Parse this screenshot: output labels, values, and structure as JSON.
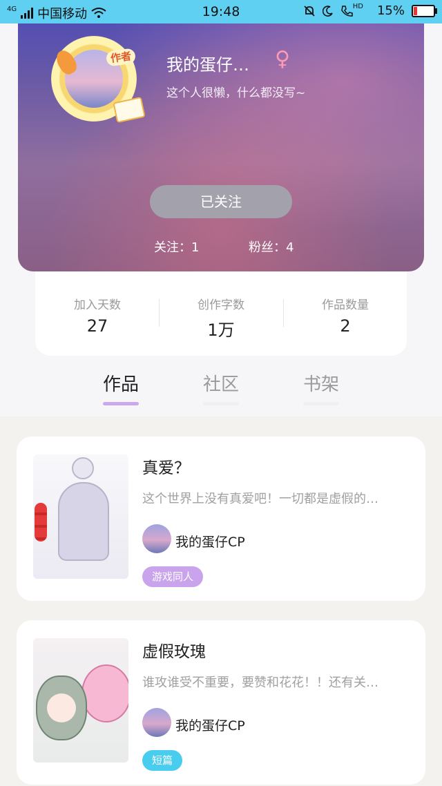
{
  "status_bar": {
    "network": "4G",
    "carrier": "中国移动",
    "time": "19:48",
    "hd": "HD",
    "battery": "15%",
    "battery_level": 0.15,
    "battery_color": "#e53935"
  },
  "profile": {
    "author_badge": "作者",
    "nickname": "我的蛋仔…",
    "gender_symbol": "♀",
    "bio": "这个人很懒，什么都没写~",
    "follow_button": "已关注",
    "following": "关注：1",
    "followers": "粉丝：4"
  },
  "stats": [
    {
      "label": "加入天数",
      "value": "27"
    },
    {
      "label": "创作字数",
      "value": "1万"
    },
    {
      "label": "作品数量",
      "value": "2"
    }
  ],
  "tabs": [
    {
      "label": "作品",
      "active": true
    },
    {
      "label": "社区",
      "active": false
    },
    {
      "label": "书架",
      "active": false
    }
  ],
  "works": [
    {
      "title": "真爱？",
      "description": "这个世界上没有真爱吧！一切都是虚假的…",
      "author": "我的蛋仔CP",
      "tag": "游戏同人",
      "tag_color": "#c9a4ec"
    },
    {
      "title": "虚假玫瑰",
      "description": "谁攻谁受不重要，要赞和花花！！还有关…",
      "author": "我的蛋仔CP",
      "tag": "短篇",
      "tag_color": "#48cdee"
    }
  ]
}
